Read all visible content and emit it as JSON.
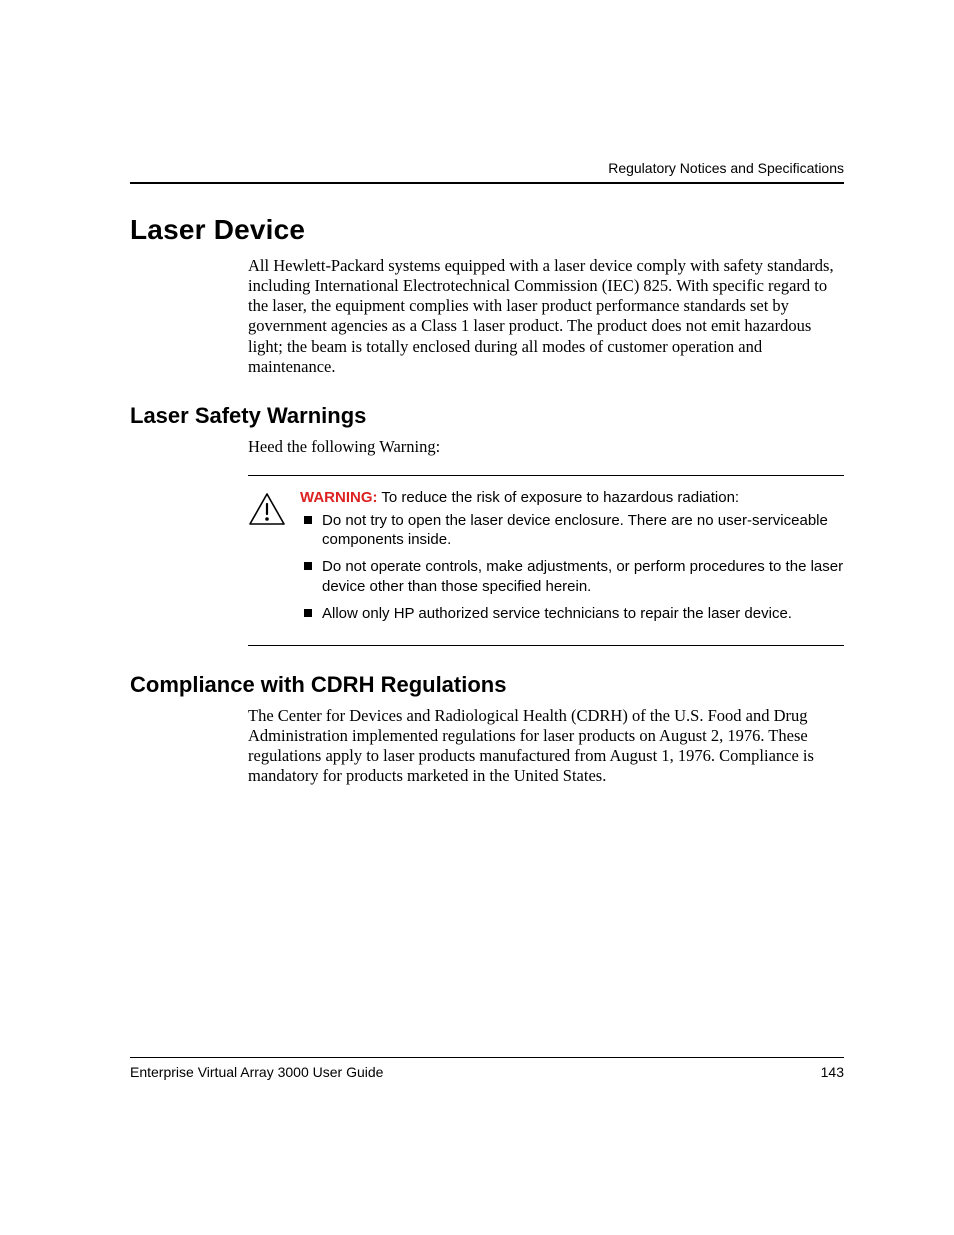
{
  "header": {
    "running_head": "Regulatory Notices and Specifications"
  },
  "sections": {
    "laser_device": {
      "title": "Laser Device",
      "body": "All Hewlett-Packard systems equipped with a laser device comply with safety standards, including International Electrotechnical Commission (IEC) 825. With specific regard to the laser, the equipment complies with laser product performance standards set by government agencies as a Class 1 laser product. The product does not emit hazardous light; the beam is totally enclosed during all modes of customer operation and maintenance."
    },
    "laser_safety": {
      "title": "Laser Safety Warnings",
      "intro": "Heed the following Warning:",
      "warning_label": "WARNING:",
      "warning_lead": "  To reduce the risk of exposure to hazardous radiation:",
      "bullets": [
        "Do not try to open the laser device enclosure. There are no user-serviceable components inside.",
        "Do not operate controls, make adjustments, or perform procedures to the laser device other than those specified herein.",
        "Allow only HP authorized service technicians to repair the laser device."
      ]
    },
    "cdrh": {
      "title": "Compliance with CDRH Regulations",
      "body": "The Center for Devices and Radiological Health (CDRH) of the U.S. Food and Drug Administration implemented regulations for laser products on August 2, 1976. These regulations apply to laser products manufactured from August 1, 1976. Compliance is mandatory for products marketed in the United States."
    }
  },
  "footer": {
    "doc_title": "Enterprise Virtual Array 3000 User Guide",
    "page_number": "143"
  }
}
